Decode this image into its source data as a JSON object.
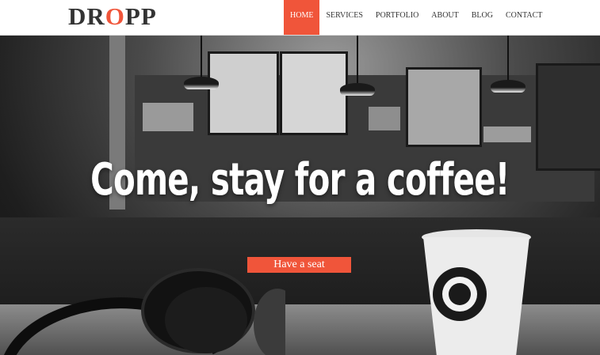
{
  "brand": {
    "logo_prefix": "DR",
    "logo_accent": "O",
    "logo_suffix": "PP",
    "accent_color": "#f0553a"
  },
  "nav": {
    "items": [
      {
        "label": "HOME",
        "active": true
      },
      {
        "label": "SERVICES",
        "active": false
      },
      {
        "label": "PORTFOLIO",
        "active": false
      },
      {
        "label": "ABOUT",
        "active": false
      },
      {
        "label": "BLOG",
        "active": false
      },
      {
        "label": "CONTACT",
        "active": false
      }
    ]
  },
  "hero": {
    "headline": "Come, stay for a coffee!",
    "cta_label": "Have a seat",
    "image": "black-and-white-coffee-shop-photo"
  }
}
